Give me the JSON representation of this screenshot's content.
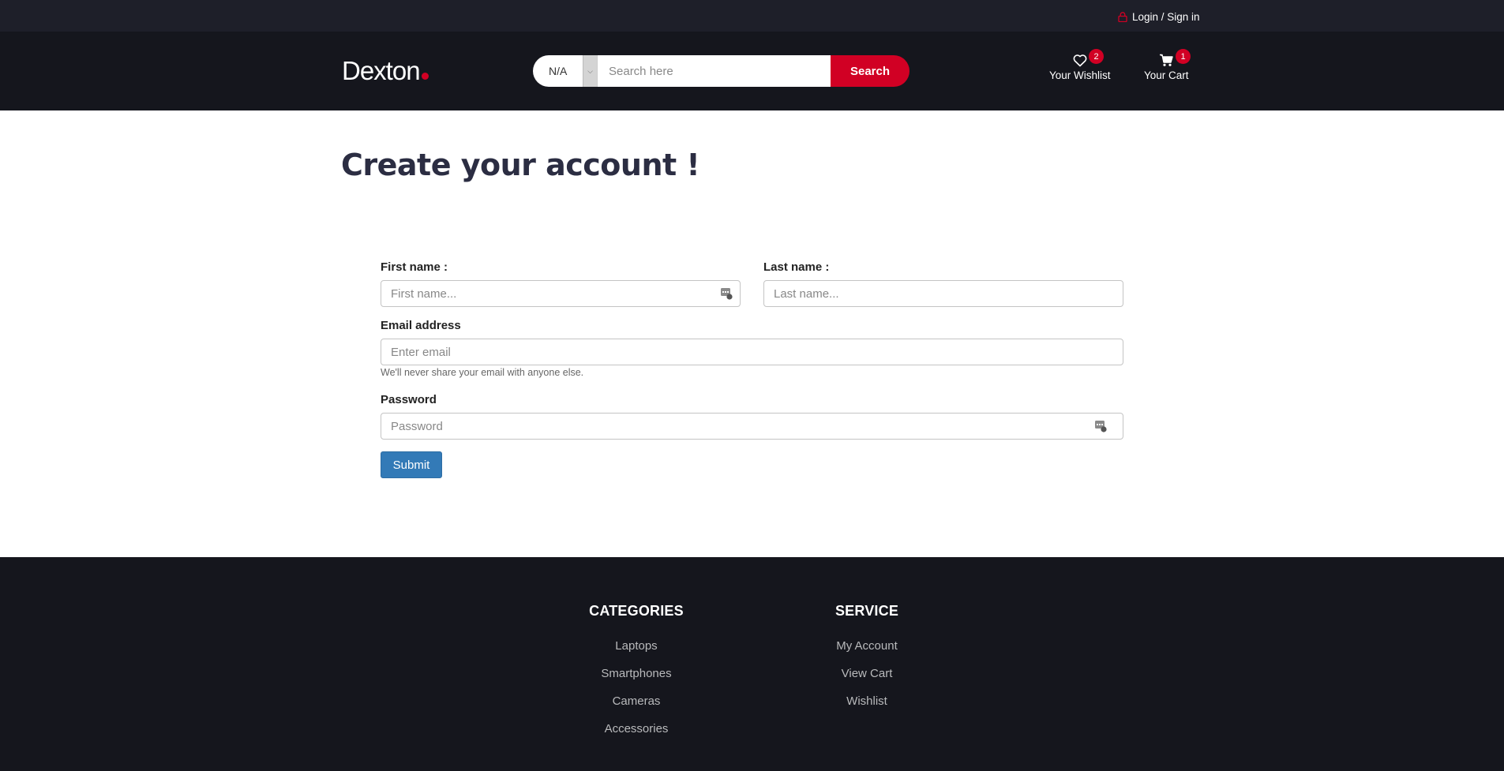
{
  "topbar": {
    "login_label": "Login / Sign in"
  },
  "header": {
    "logo_text": "Dexton",
    "search": {
      "category_value": "N/A",
      "placeholder": "Search here",
      "button_label": "Search"
    },
    "wishlist": {
      "label": "Your Wishlist",
      "count": "2"
    },
    "cart": {
      "label": "Your Cart",
      "count": "1"
    }
  },
  "main": {
    "title": "Create your account !",
    "form": {
      "first_name_label": "First name :",
      "first_name_placeholder": "First name...",
      "last_name_label": "Last name :",
      "last_name_placeholder": "Last name...",
      "email_label": "Email address",
      "email_placeholder": "Enter email",
      "email_help": "We'll never share your email with anyone else.",
      "password_label": "Password",
      "password_placeholder": "Password",
      "submit_label": "Submit"
    }
  },
  "footer": {
    "categories": {
      "title": "CATEGORIES",
      "links": [
        "Laptops",
        "Smartphones",
        "Cameras",
        "Accessories"
      ]
    },
    "service": {
      "title": "SERVICE",
      "links": [
        "My Account",
        "View Cart",
        "Wishlist"
      ]
    }
  },
  "colors": {
    "accent": "#d10024",
    "header_bg": "#15161d",
    "topbar_bg": "#1e1f29",
    "submit_bg": "#337ab7",
    "title": "#2b2d42"
  }
}
